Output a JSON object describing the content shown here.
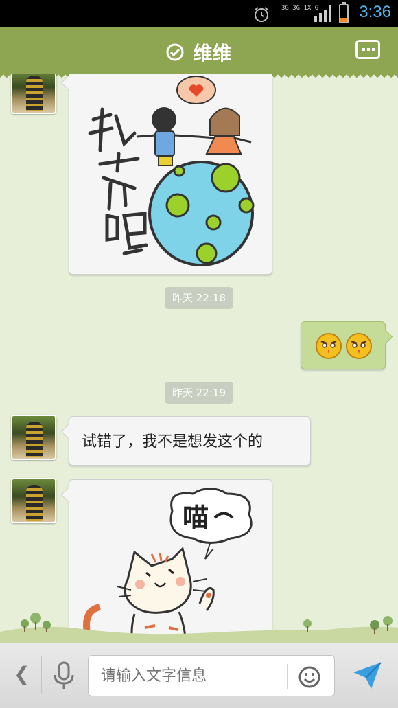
{
  "status_bar": {
    "time": "3:36",
    "network": "3G 3G 1X G",
    "icons": [
      "alarm-icon",
      "network-type-icon",
      "signal-icon",
      "battery-icon"
    ],
    "battery_color": "#f08a24",
    "accent_color": "#4fb6ea"
  },
  "header": {
    "title": "维维",
    "verified_icon": "check-circle-icon",
    "more_icon": "more-dots-icon",
    "background_color": "#8ea552"
  },
  "messages": [
    {
      "side": "incoming",
      "type": "sticker",
      "sticker_text": "私奔吧~"
    },
    {
      "type": "timestamp",
      "text": "昨天 22:18"
    },
    {
      "side": "outgoing",
      "type": "emoji",
      "emojis": [
        "angry-face-icon",
        "angry-face-icon"
      ]
    },
    {
      "type": "timestamp",
      "text": "昨天 22:19"
    },
    {
      "side": "incoming",
      "type": "text",
      "text": "试错了，我不是想发这个的"
    },
    {
      "side": "incoming",
      "type": "sticker",
      "sticker_text": "喵~"
    }
  ],
  "input_bar": {
    "placeholder": "请输入文字信息",
    "icons": [
      "back-chevron-icon",
      "microphone-icon",
      "emoji-icon",
      "send-icon"
    ]
  }
}
